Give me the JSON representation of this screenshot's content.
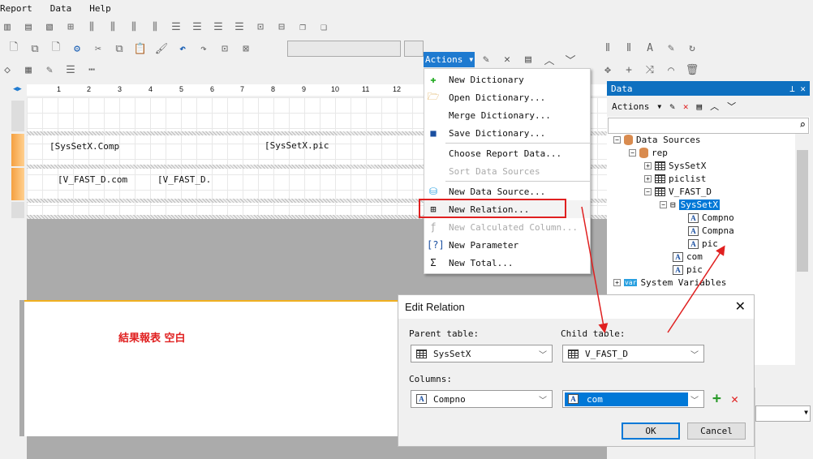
{
  "menubar": {
    "items": [
      "Report",
      "Data",
      "Help"
    ]
  },
  "ruler": {
    "ticks": [
      "1",
      "2",
      "3",
      "4",
      "5",
      "6",
      "7",
      "8",
      "9",
      "10",
      "11",
      "12"
    ]
  },
  "report": {
    "fields": [
      "[SysSetX.Comp",
      "[SysSetX.pic",
      "[V_FAST_D.com",
      "[V_FAST_D."
    ]
  },
  "actions_menu": {
    "button": "Actions",
    "items": [
      {
        "label": "New Dictionary",
        "icon": "new-dictionary-icon",
        "enabled": true
      },
      {
        "label": "Open Dictionary...",
        "icon": "open-folder-icon",
        "enabled": true
      },
      {
        "label": "Merge Dictionary...",
        "icon": "",
        "enabled": true
      },
      {
        "label": "Save Dictionary...",
        "icon": "save-icon",
        "enabled": true
      },
      {
        "label": "Choose Report Data...",
        "icon": "",
        "enabled": true
      },
      {
        "label": "Sort Data Sources",
        "icon": "",
        "enabled": false
      },
      {
        "label": "New Data Source...",
        "icon": "new-datasource-icon",
        "enabled": true
      },
      {
        "label": "New Relation...",
        "icon": "new-relation-icon",
        "enabled": true,
        "highlighted": true
      },
      {
        "label": "New Calculated Column...",
        "icon": "calc-column-icon",
        "enabled": false
      },
      {
        "label": "New Parameter",
        "icon": "parameter-icon",
        "enabled": true
      },
      {
        "label": "New Total...",
        "icon": "sigma-icon",
        "enabled": true
      }
    ]
  },
  "data_panel": {
    "title": "Data",
    "actions": "Actions",
    "search_placeholder": "",
    "tree": [
      "Data Sources",
      "rep",
      "SysSetX",
      "piclist",
      "V_FAST_D",
      "SysSetX",
      "Compno",
      "Compna",
      "pic",
      "com",
      "pic",
      "System Variables"
    ]
  },
  "dialog": {
    "title": "Edit Relation",
    "parent_label": "Parent table:",
    "child_label": "Child table:",
    "parent_table": "SysSetX",
    "child_table": "V_FAST_D",
    "columns_label": "Columns:",
    "parent_column": "Compno",
    "child_column": "com",
    "ok": "OK",
    "cancel": "Cancel"
  },
  "annotation": {
    "text": "結果報表 空白",
    "color": "#e02020"
  },
  "colors": {
    "accent": "#0e70c0",
    "highlight": "#0078d7",
    "annotation_red": "#e02020",
    "band_orange": "#f5a040"
  }
}
